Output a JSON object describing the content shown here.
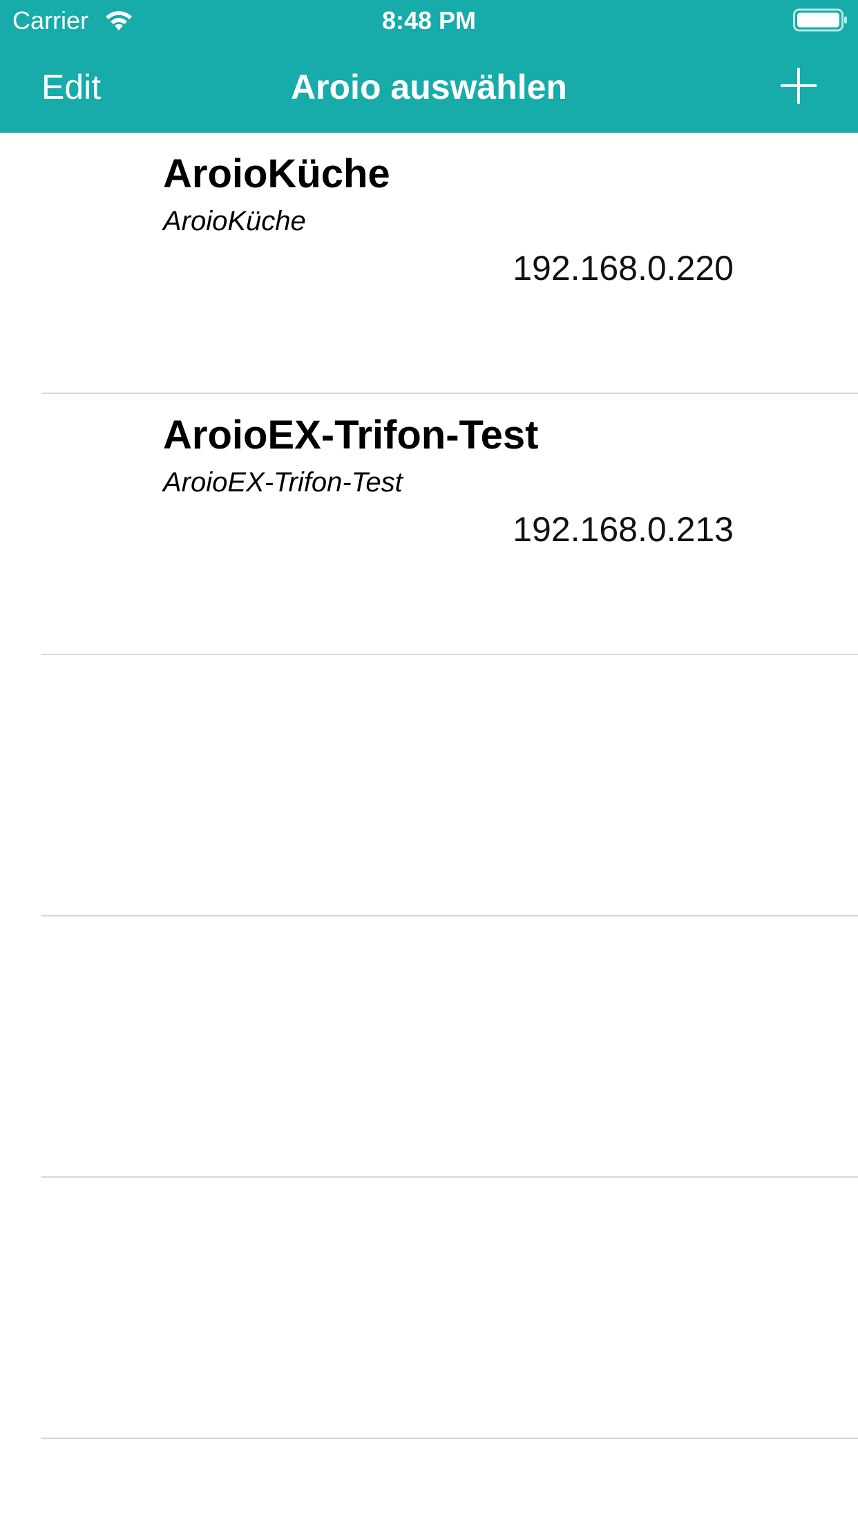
{
  "status_bar": {
    "carrier": "Carrier",
    "time": "8:48 PM",
    "wifi_icon": "wifi-icon",
    "battery_icon": "battery-icon"
  },
  "nav_bar": {
    "edit_label": "Edit",
    "title": "Aroio auswählen",
    "add_icon": "plus-icon",
    "background_color": "#17abaa"
  },
  "devices": [
    {
      "name": "AroioKüche",
      "subtitle": "AroioKüche",
      "ip": "192.168.0.220"
    },
    {
      "name": "AroioEX-Trifon-Test",
      "subtitle": "AroioEX-Trifon-Test",
      "ip": "192.168.0.213"
    }
  ]
}
